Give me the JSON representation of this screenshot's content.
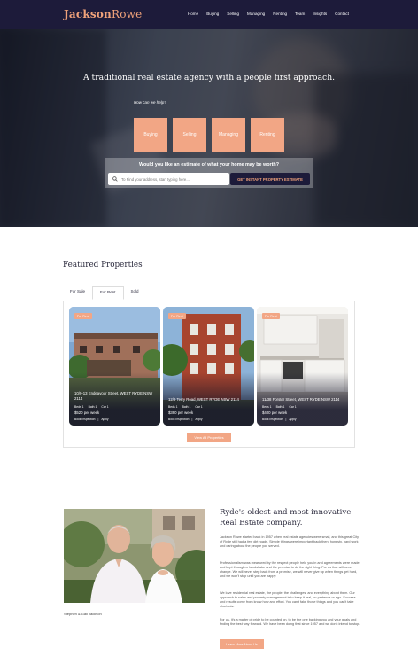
{
  "brand": {
    "name_bold": "Jackson",
    "name_light": "Rowe",
    "accent": "#f2a685",
    "navy": "#1d1b3a"
  },
  "nav": {
    "items": [
      "Home",
      "Buying",
      "Selling",
      "Managing",
      "Renting",
      "Team",
      "Insights",
      "Contact"
    ]
  },
  "hero": {
    "title": "A traditional real estate agency with a people first approach.",
    "help": "How can we help?",
    "buttons": [
      "Buying",
      "Selling",
      "Managing",
      "Renting"
    ],
    "estimate_question": "Would you like an estimate of what your home may be worth?",
    "search_placeholder": "To Find your address, start typing here...",
    "estimate_button": "GET INSTANT PROPERTY ESTIMATE"
  },
  "featured": {
    "title": "Featured Properties",
    "tabs": [
      "For Sale",
      "For Rent",
      "Sold"
    ],
    "active_tab": "For Rent",
    "cards": [
      {
        "badge": "For Rent",
        "address": "10/9-13 Endeavour Street, WEST RYDE NSW 2114",
        "beds": "Beds 1",
        "bath": "Bath 1",
        "car": "Car 1",
        "price": "$520 per week",
        "inspect": "Book Inspection",
        "apply": "Apply"
      },
      {
        "badge": "For Rent",
        "address": "12/9 Terry Road, WEST RYDE NSW 2114",
        "beds": "Beds 1",
        "bath": "Bath 1",
        "car": "Car 1",
        "price": "$390 per week",
        "inspect": "Book Inspection",
        "apply": "Apply"
      },
      {
        "badge": "For Rent",
        "address": "11/38 Forster Street, WEST RYDE NSW 2114",
        "beds": "Beds 1",
        "bath": "Bath 1",
        "car": "Car 1",
        "price": "$400 per week",
        "inspect": "Book Inspection",
        "apply": "Apply"
      }
    ],
    "view_all": "View All Properties"
  },
  "about": {
    "caption": "Stephen & Gail Jackson",
    "title": "Ryde's oldest and most innovative Real Estate company.",
    "paragraphs": [
      "Jackson Rowe started back in 1957 when real estate agencies were small, and this great City of Ryde still had a few dirt roads. Simple things were important back then; honesty, hard work and caring about the people you served.",
      "Professionalism was measured by the respect people held you in and agreements were made and kept through a handshake and the promise to do the right thing. For us that will never change. We will never step back from a promise, we will never give up when things get hard, and we won't stop until you are happy.",
      "We love residential real estate, the people, the challenges, and everything about them. Our approach to sales and property management is to keep it real, no pretence or ego. Success and results come from know how and effort. You can't fake those things and you can't take shortcuts.",
      "For us, it's a matter of pride to be counted on, to be the one backing you and your goals and finding the best way forward. We have been doing that since 1957 and we don't intend to stop."
    ],
    "button": "Learn More About Us"
  }
}
